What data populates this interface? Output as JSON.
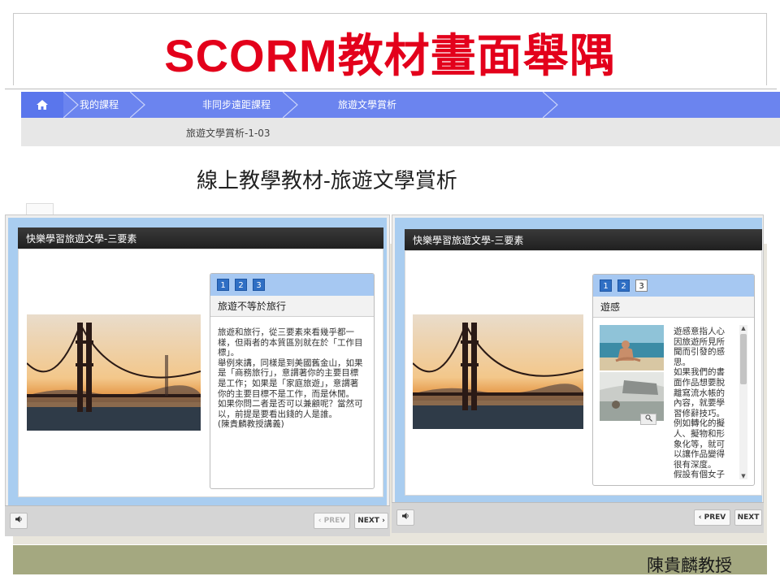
{
  "slide": {
    "title": "SCORM教材畫面舉隅",
    "author": "陳貴麟教授"
  },
  "breadcrumb": {
    "home_icon": "home-icon",
    "items": [
      "我的課程",
      "非同步遠距課程",
      "旅遊文學賞析"
    ],
    "current_page": "旅遊文學賞析-1-03"
  },
  "page": {
    "heading": "線上教學教材-旅遊文學賞析"
  },
  "players": [
    {
      "header": "快樂學習旅遊文學-三要素",
      "pages": [
        "1",
        "2",
        "3"
      ],
      "active_page": "",
      "panel_title": "旅遊不等於旅行",
      "body": "旅遊和旅行，從三要素來看幾乎都一\n樣，但兩者的本質區別就在於「工作目\n標」。\n舉例來講，同樣是到美國舊金山，如果\n是「商務旅行」，意謂著你的主要目標\n是工作；如果是「家庭旅遊」，意謂著\n你的主要目標不是工作，而是休閒。\n如果你問二者是否可以兼顧呢？當然可\n以，前提是要看出錢的人是誰。\n(陳貴麟教授講義)",
      "prev_label": "‹ PREV",
      "next_label": "NEXT ›"
    },
    {
      "header": "快樂學習旅遊文學-三要素",
      "pages": [
        "1",
        "2",
        "3"
      ],
      "active_page": "3",
      "panel_title": "遊感",
      "body": "遊感意指人心\n因旅遊所見所\n聞而引發的感\n思。\n如果我們的書\n面作品想要脫\n離寫流水帳的\n內容，就要學\n習修辭技巧。\n例如轉化的擬\n人、擬物和形\n象化等，就可\n以讓作品變得\n很有深度。\n假設有個女子",
      "prev_label": "‹ PREV",
      "next_label": "NEXT"
    }
  ],
  "colors": {
    "title_red": "#e3001b",
    "breadcrumb_blue": "#6b84ef",
    "player_blue": "#a9cdf0",
    "footer_olive": "#a4a880"
  }
}
